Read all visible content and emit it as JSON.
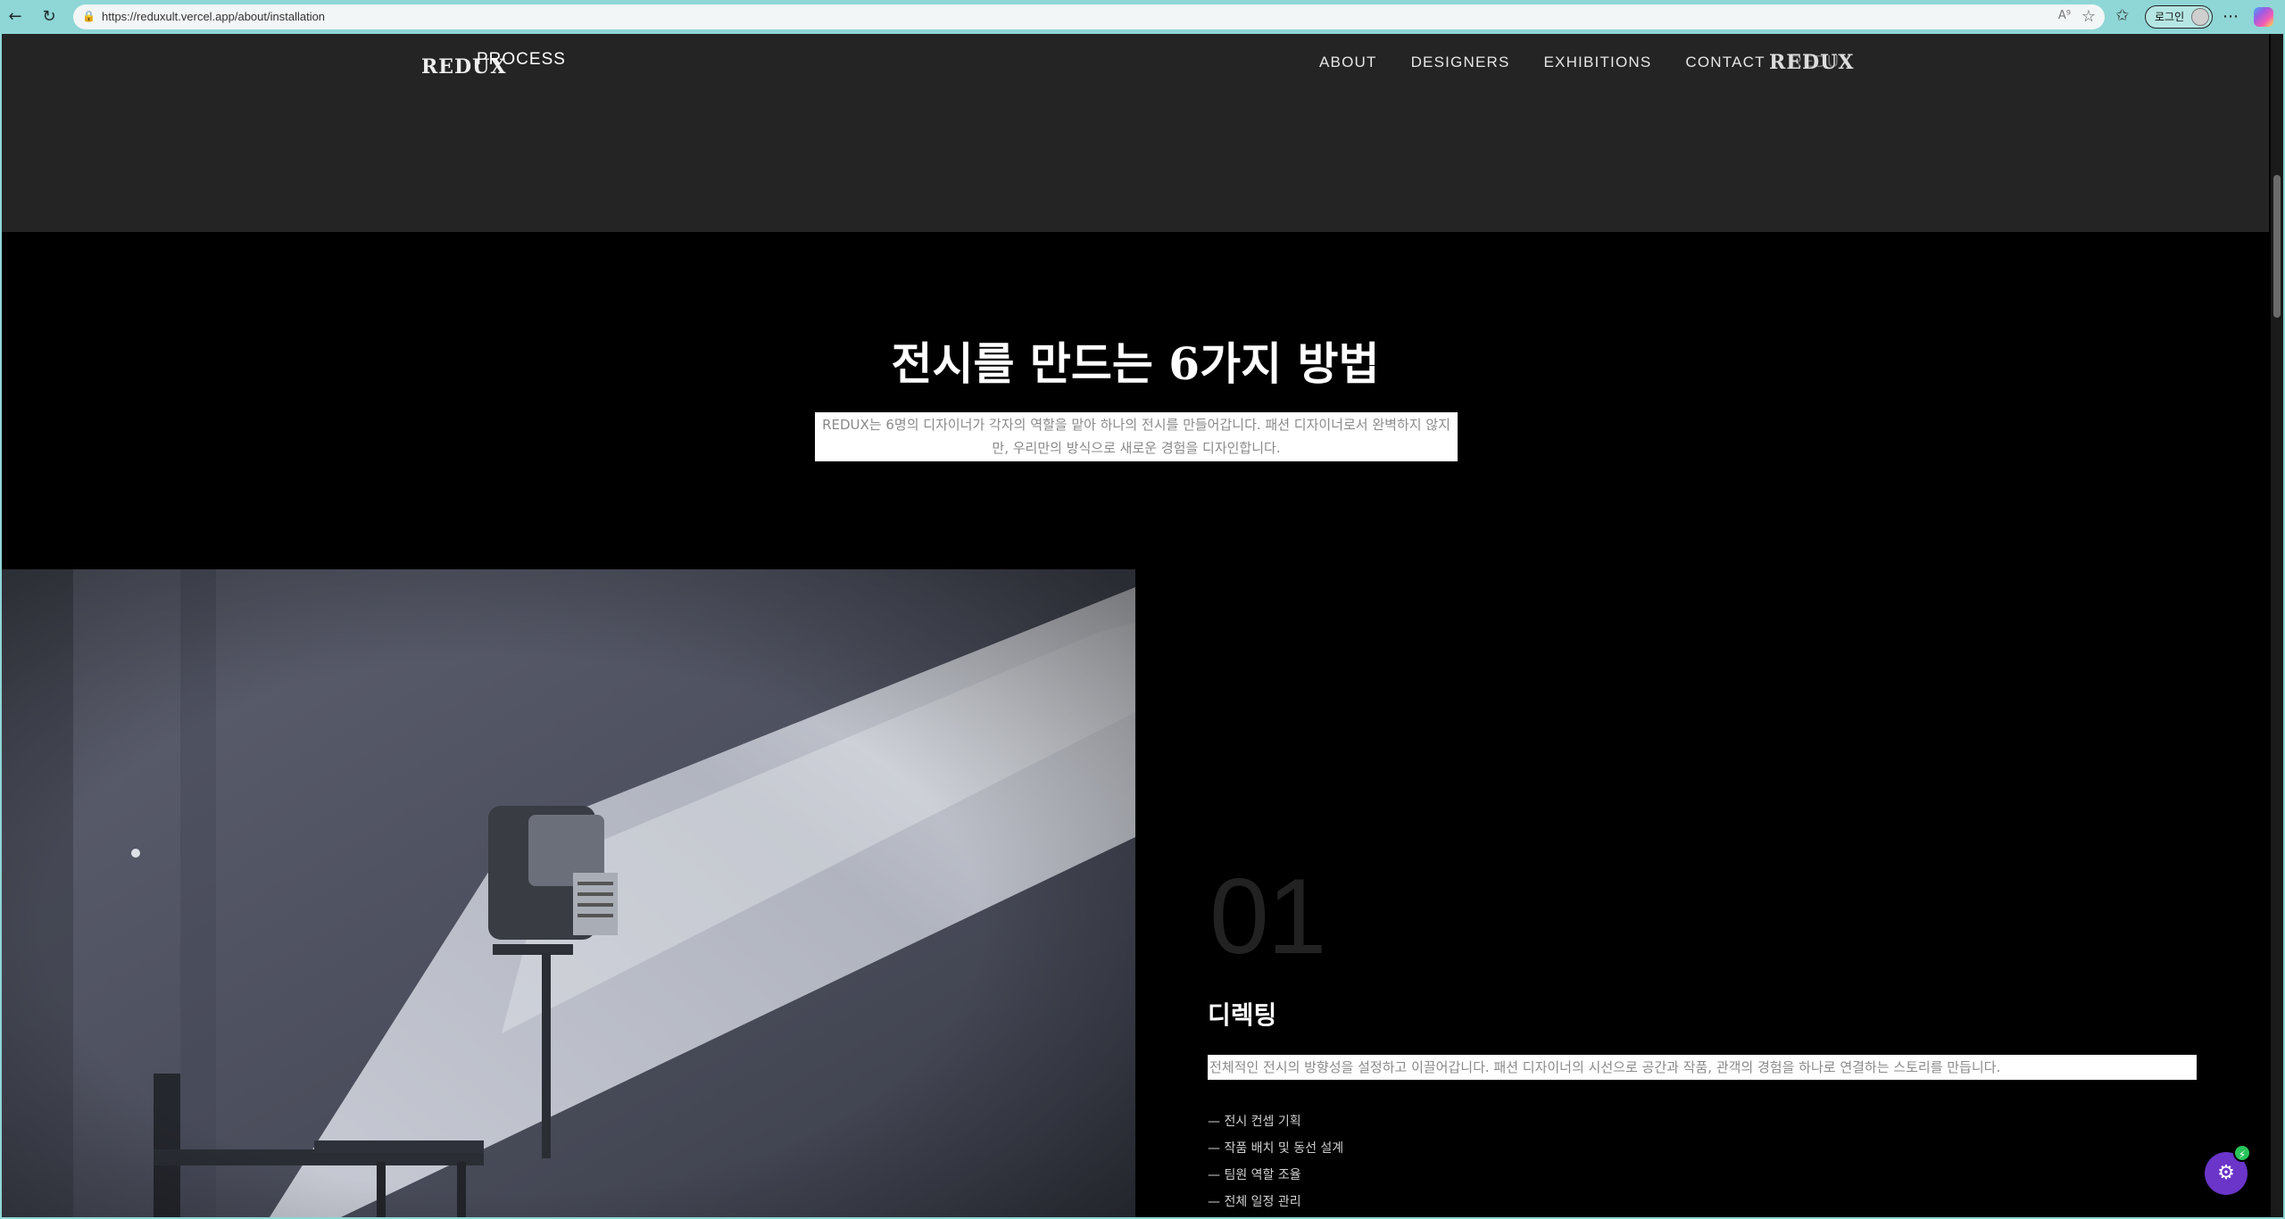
{
  "browser": {
    "url": "https://reduxult.vercel.app/about/installation",
    "login_label": "로그인",
    "icons": {
      "back": "arrow-left-icon",
      "refresh": "refresh-icon",
      "lock": "lock-icon",
      "read_aloud": "read-aloud-icon",
      "favorite": "star-icon",
      "favorites_bar": "favorites-icon",
      "more": "more-icon",
      "copilot": "copilot-icon"
    }
  },
  "header": {
    "logo": "REDUX",
    "logo_sub": "PROCESS",
    "nav": [
      "ABOUT",
      "DESIGNERS",
      "EXHIBITIONS",
      "CONTACT"
    ],
    "nav_logo": "REDUX",
    "nav_logo_ghost": "REDUX"
  },
  "intro": {
    "title": "전시를 만드는 6가지 방법",
    "description": "REDUX는 6명의 디자이너가 각자의 역할을 맡아 하나의 전시를 만들어갑니다. 패션 디자이너로서 완벽하지 않지만, 우리만의 방식으로 새로운 경험을 디자인합니다."
  },
  "step": {
    "number": "01",
    "title": "디렉팅",
    "description": "전체적인 전시의 방향성을 설정하고 이끌어갑니다. 패션 디자이너의 시선으로 공간과 작품, 관객의 경험을 하나로 연결하는 스토리를 만듭니다.",
    "items": [
      "— 전시 컨셉 기획",
      "— 작품 배치 및 동선 설계",
      "— 팀원 역할 조율",
      "— 전체 일정 관리"
    ]
  },
  "colors": {
    "browser_frame": "#8fd6d6",
    "header_band": "#242424",
    "page_bg": "#000000",
    "fab": "#6a35c8",
    "fab_badge": "#28c45a"
  }
}
